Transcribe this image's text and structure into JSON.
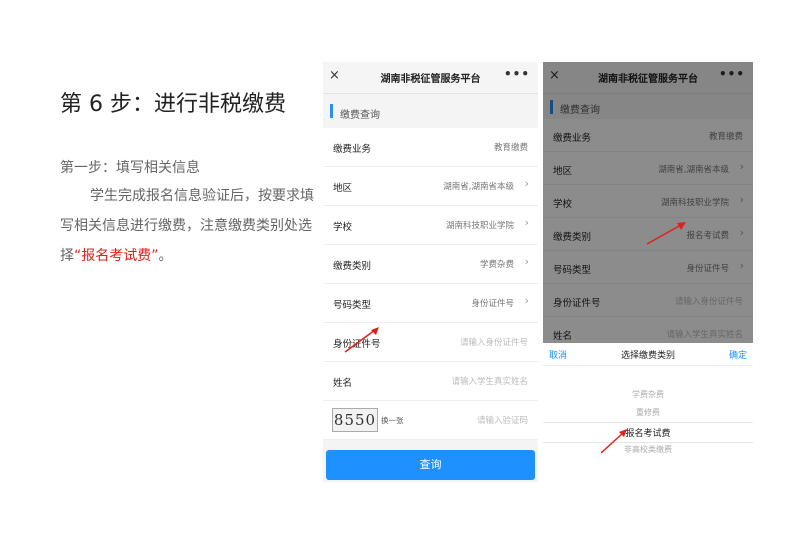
{
  "slide": {
    "title": "第 6 步：进行非税缴费",
    "step_label": "第一步：填写相关信息",
    "body_pre": "学生完成报名信息验证后，按要求填写相关信息进行缴费，注意缴费类别处选择",
    "body_highlight": "“报名考试费”",
    "body_post": "。"
  },
  "phone1": {
    "close_icon": "×",
    "title": "湖南非税征管服务平台",
    "more_icon": "•••",
    "section": "缴费查询",
    "rows": [
      {
        "label": "缴费业务",
        "value": "教育缴费"
      },
      {
        "label": "地区",
        "value": "湖南省,湖南省本级"
      },
      {
        "label": "学校",
        "value": "湖南科技职业学院"
      },
      {
        "label": "缴费类别",
        "value": "学费杂费"
      },
      {
        "label": "号码类型",
        "value": "身份证件号"
      },
      {
        "label": "身份证件号",
        "value": "请输入身份证件号"
      },
      {
        "label": "姓名",
        "value": "请输入学生真实姓名"
      }
    ],
    "captcha": {
      "code": "8550",
      "refresh": "换一张",
      "placeholder": "请输入验证码"
    },
    "chevron": "›",
    "query_button": "查询"
  },
  "phone2": {
    "close_icon": "×",
    "title": "湖南非税征管服务平台",
    "more_icon": "•••",
    "section": "缴费查询",
    "rows": [
      {
        "label": "缴费业务",
        "value": "教育缴费"
      },
      {
        "label": "地区",
        "value": "湖南省,湖南省本级"
      },
      {
        "label": "学校",
        "value": "湖南科技职业学院"
      },
      {
        "label": "缴费类别",
        "value": "报名考试费"
      },
      {
        "label": "号码类型",
        "value": "身份证件号"
      },
      {
        "label": "身份证件号",
        "value": "请输入身份证件号"
      },
      {
        "label": "姓名",
        "value": "请输入学生真实姓名"
      }
    ],
    "chevron": "›",
    "picker": {
      "cancel": "取消",
      "title": "选择缴费类别",
      "confirm": "确定",
      "options": [
        "学费杂费",
        "重修费",
        "报名考试费",
        "非高校类缴费"
      ],
      "selected": "报名考试费"
    }
  },
  "colors": {
    "accent": "#1e90ff",
    "highlight": "#e0201a",
    "arrow": "#e0201a"
  }
}
